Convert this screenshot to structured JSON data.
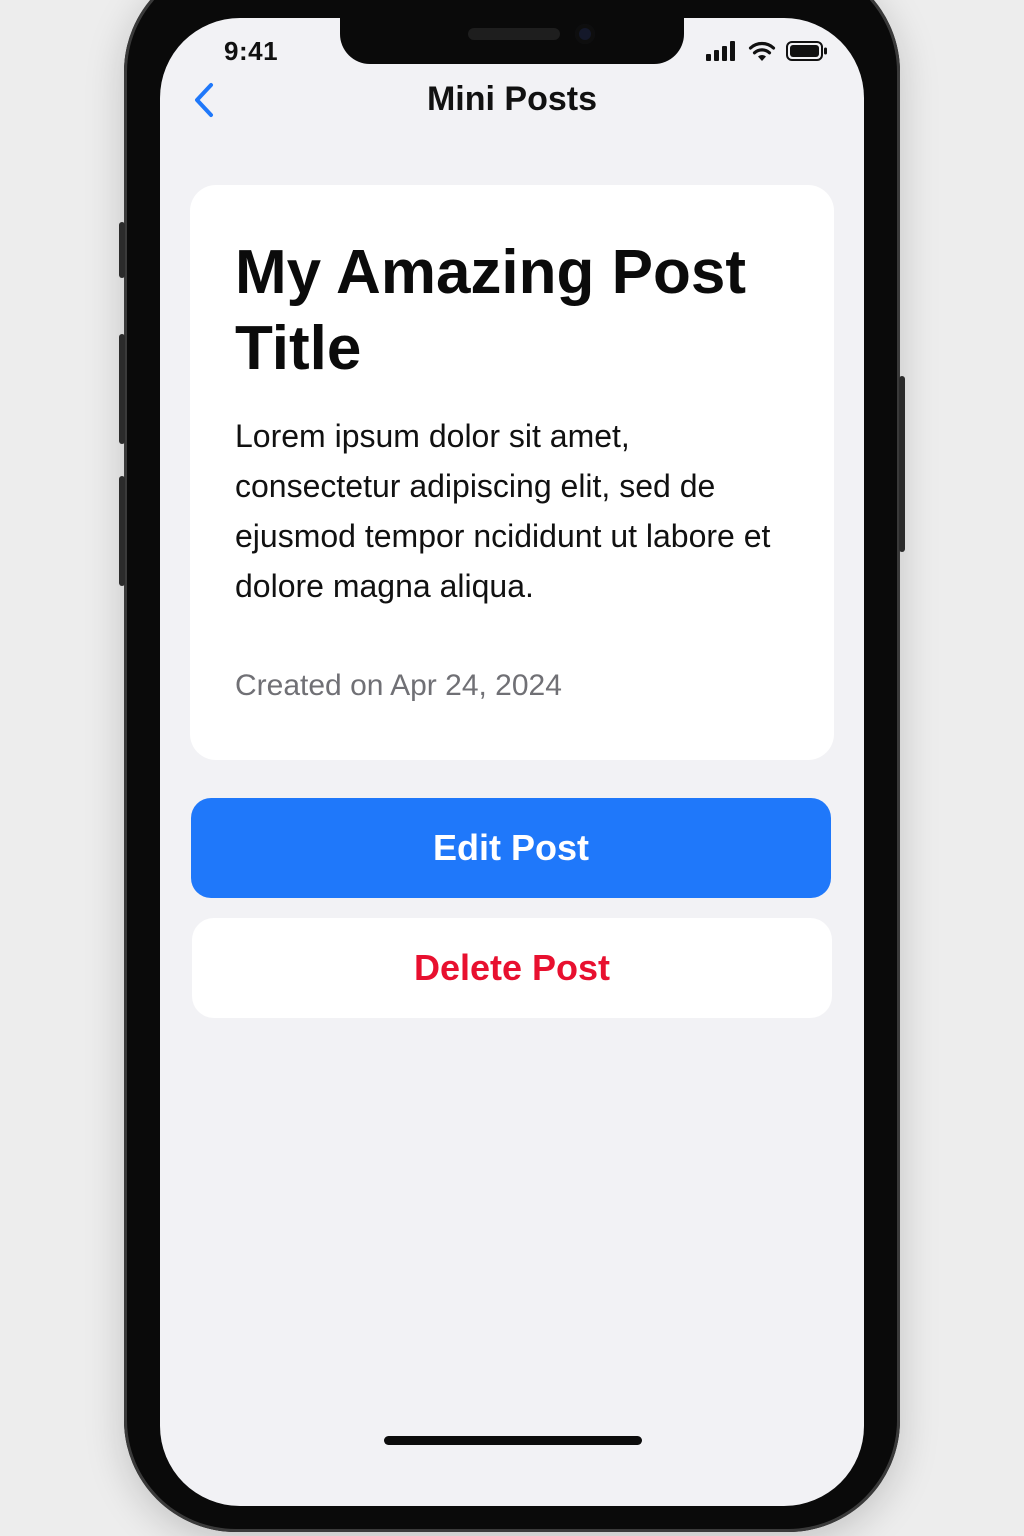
{
  "status_bar": {
    "time": "9:41",
    "icons": [
      "cellular-signal-icon",
      "wifi-icon",
      "battery-icon"
    ]
  },
  "nav": {
    "title": "Mini Posts",
    "back_icon": "chevron-left-icon"
  },
  "post": {
    "title": "My Amazing Post Title",
    "body": "Lorem ipsum dolor sit amet, consectetur adipiscing elit, sed de ejusmod tempor ncididunt ut labore et dolore magna aliqua.",
    "created": "Created on Apr 24, 2024"
  },
  "actions": {
    "edit_label": "Edit Post",
    "delete_label": "Delete Post"
  },
  "colors": {
    "accent": "#1f78fa",
    "destructive": "#e8102f",
    "background": "#f2f2f5",
    "card": "#ffffff",
    "secondary_text": "#707075"
  }
}
